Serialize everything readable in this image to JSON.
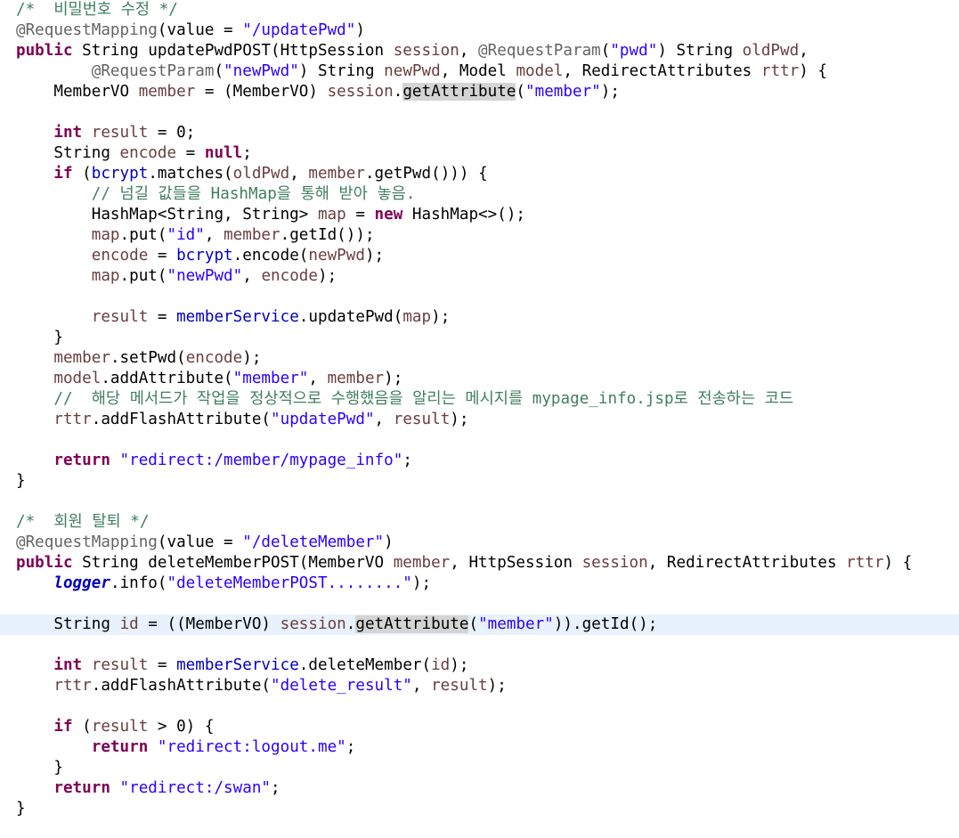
{
  "code_lines": [
    [
      {
        "t": "/*  비밀번호 수정 */",
        "c": "cm"
      }
    ],
    [
      {
        "t": "@RequestMapping",
        "c": "ann"
      },
      {
        "t": "(value = "
      },
      {
        "t": "\"/updatePwd\"",
        "c": "str"
      },
      {
        "t": ")"
      }
    ],
    [
      {
        "t": "public",
        "c": "kw"
      },
      {
        "t": " String updatePwdPOST(HttpSession "
      },
      {
        "t": "session",
        "c": "loc"
      },
      {
        "t": ", "
      },
      {
        "t": "@RequestParam",
        "c": "ann"
      },
      {
        "t": "("
      },
      {
        "t": "\"pwd\"",
        "c": "str"
      },
      {
        "t": ") String "
      },
      {
        "t": "oldPwd",
        "c": "loc"
      },
      {
        "t": ","
      }
    ],
    [
      {
        "t": "        "
      },
      {
        "t": "@RequestParam",
        "c": "ann"
      },
      {
        "t": "("
      },
      {
        "t": "\"newPwd\"",
        "c": "str"
      },
      {
        "t": ") String "
      },
      {
        "t": "newPwd",
        "c": "loc"
      },
      {
        "t": ", Model "
      },
      {
        "t": "model",
        "c": "loc"
      },
      {
        "t": ", RedirectAttributes "
      },
      {
        "t": "rttr",
        "c": "loc"
      },
      {
        "t": ") {"
      }
    ],
    [
      {
        "t": "    MemberVO "
      },
      {
        "t": "member",
        "c": "loc"
      },
      {
        "t": " = (MemberVO) "
      },
      {
        "t": "session",
        "c": "loc"
      },
      {
        "t": "."
      },
      {
        "t": "getAttribute",
        "c": "hl"
      },
      {
        "t": "("
      },
      {
        "t": "\"member\"",
        "c": "str"
      },
      {
        "t": ");"
      }
    ],
    [],
    [
      {
        "t": "    "
      },
      {
        "t": "int",
        "c": "kw"
      },
      {
        "t": " "
      },
      {
        "t": "result",
        "c": "loc"
      },
      {
        "t": " = 0;"
      }
    ],
    [
      {
        "t": "    String "
      },
      {
        "t": "encode",
        "c": "loc"
      },
      {
        "t": " = "
      },
      {
        "t": "null",
        "c": "kw"
      },
      {
        "t": ";"
      }
    ],
    [
      {
        "t": "    "
      },
      {
        "t": "if",
        "c": "kw"
      },
      {
        "t": " ("
      },
      {
        "t": "bcrypt",
        "c": "fld"
      },
      {
        "t": ".matches("
      },
      {
        "t": "oldPwd",
        "c": "loc"
      },
      {
        "t": ", "
      },
      {
        "t": "member",
        "c": "loc"
      },
      {
        "t": ".getPwd())) {"
      }
    ],
    [
      {
        "t": "        "
      },
      {
        "t": "// 넘길 값들을 HashMap을 통해 받아 놓음.",
        "c": "cm"
      }
    ],
    [
      {
        "t": "        HashMap<String, String> "
      },
      {
        "t": "map",
        "c": "loc"
      },
      {
        "t": " = "
      },
      {
        "t": "new",
        "c": "kw"
      },
      {
        "t": " HashMap<>();"
      }
    ],
    [
      {
        "t": "        "
      },
      {
        "t": "map",
        "c": "loc"
      },
      {
        "t": ".put("
      },
      {
        "t": "\"id\"",
        "c": "str"
      },
      {
        "t": ", "
      },
      {
        "t": "member",
        "c": "loc"
      },
      {
        "t": ".getId());"
      }
    ],
    [
      {
        "t": "        "
      },
      {
        "t": "encode",
        "c": "loc"
      },
      {
        "t": " = "
      },
      {
        "t": "bcrypt",
        "c": "fld"
      },
      {
        "t": ".encode("
      },
      {
        "t": "newPwd",
        "c": "loc"
      },
      {
        "t": ");"
      }
    ],
    [
      {
        "t": "        "
      },
      {
        "t": "map",
        "c": "loc"
      },
      {
        "t": ".put("
      },
      {
        "t": "\"newPwd\"",
        "c": "str"
      },
      {
        "t": ", "
      },
      {
        "t": "encode",
        "c": "loc"
      },
      {
        "t": ");"
      }
    ],
    [],
    [
      {
        "t": "        "
      },
      {
        "t": "result",
        "c": "loc"
      },
      {
        "t": " = "
      },
      {
        "t": "memberService",
        "c": "fld"
      },
      {
        "t": ".updatePwd("
      },
      {
        "t": "map",
        "c": "loc"
      },
      {
        "t": ");"
      }
    ],
    [
      {
        "t": "    }"
      }
    ],
    [
      {
        "t": "    "
      },
      {
        "t": "member",
        "c": "loc"
      },
      {
        "t": ".setPwd("
      },
      {
        "t": "encode",
        "c": "loc"
      },
      {
        "t": ");"
      }
    ],
    [
      {
        "t": "    "
      },
      {
        "t": "model",
        "c": "loc"
      },
      {
        "t": ".addAttribute("
      },
      {
        "t": "\"member\"",
        "c": "str"
      },
      {
        "t": ", "
      },
      {
        "t": "member",
        "c": "loc"
      },
      {
        "t": ");"
      }
    ],
    [
      {
        "t": "    "
      },
      {
        "t": "//  해당 메서드가 작업을 정상적으로 수행했음을 알리는 메시지를 mypage_info.jsp로 전송하는 코드",
        "c": "cm"
      }
    ],
    [
      {
        "t": "    "
      },
      {
        "t": "rttr",
        "c": "loc"
      },
      {
        "t": ".addFlashAttribute("
      },
      {
        "t": "\"updatePwd\"",
        "c": "str"
      },
      {
        "t": ", "
      },
      {
        "t": "result",
        "c": "loc"
      },
      {
        "t": ");"
      }
    ],
    [],
    [
      {
        "t": "    "
      },
      {
        "t": "return",
        "c": "kw"
      },
      {
        "t": " "
      },
      {
        "t": "\"redirect:/member/mypage_info\"",
        "c": "str"
      },
      {
        "t": ";"
      }
    ],
    [
      {
        "t": "}"
      }
    ],
    [],
    [
      {
        "t": "/*  회원 탈퇴 */",
        "c": "cm"
      }
    ],
    [
      {
        "t": "@RequestMapping",
        "c": "ann"
      },
      {
        "t": "(value = "
      },
      {
        "t": "\"/deleteMember\"",
        "c": "str"
      },
      {
        "t": ")"
      }
    ],
    [
      {
        "t": "public",
        "c": "kw"
      },
      {
        "t": " String deleteMemberPOST(MemberVO "
      },
      {
        "t": "member",
        "c": "loc"
      },
      {
        "t": ", HttpSession "
      },
      {
        "t": "session",
        "c": "loc"
      },
      {
        "t": ", RedirectAttributes "
      },
      {
        "t": "rttr",
        "c": "loc"
      },
      {
        "t": ") {"
      }
    ],
    [
      {
        "t": "    "
      },
      {
        "t": "logger",
        "c": "sfld"
      },
      {
        "t": ".info("
      },
      {
        "t": "\"deleteMemberPOST........\"",
        "c": "str"
      },
      {
        "t": ");"
      }
    ],
    [],
    [
      {
        "t": "    String "
      },
      {
        "t": "id",
        "c": "loc"
      },
      {
        "t": " = ((MemberVO) "
      },
      {
        "t": "session",
        "c": "loc"
      },
      {
        "t": "."
      },
      {
        "t": "get",
        "c": "hl"
      },
      {
        "caret": true
      },
      {
        "t": "Attribute",
        "c": "hl"
      },
      {
        "t": "("
      },
      {
        "t": "\"member\"",
        "c": "str"
      },
      {
        "t": ")).getId();"
      }
    ],
    [],
    [
      {
        "t": "    "
      },
      {
        "t": "int",
        "c": "kw"
      },
      {
        "t": " "
      },
      {
        "t": "result",
        "c": "loc"
      },
      {
        "t": " = "
      },
      {
        "t": "memberService",
        "c": "fld"
      },
      {
        "t": ".deleteMember("
      },
      {
        "t": "id",
        "c": "loc"
      },
      {
        "t": ");"
      }
    ],
    [
      {
        "t": "    "
      },
      {
        "t": "rttr",
        "c": "loc"
      },
      {
        "t": ".addFlashAttribute("
      },
      {
        "t": "\"delete_result\"",
        "c": "str"
      },
      {
        "t": ", "
      },
      {
        "t": "result",
        "c": "loc"
      },
      {
        "t": ");"
      }
    ],
    [],
    [
      {
        "t": "    "
      },
      {
        "t": "if",
        "c": "kw"
      },
      {
        "t": " ("
      },
      {
        "t": "result",
        "c": "loc"
      },
      {
        "t": " > 0) {"
      }
    ],
    [
      {
        "t": "        "
      },
      {
        "t": "return",
        "c": "kw"
      },
      {
        "t": " "
      },
      {
        "t": "\"redirect:logout.me\"",
        "c": "str"
      },
      {
        "t": ";"
      }
    ],
    [
      {
        "t": "    }"
      }
    ],
    [
      {
        "t": "    "
      },
      {
        "t": "return",
        "c": "kw"
      },
      {
        "t": " "
      },
      {
        "t": "\"redirect:/swan\"",
        "c": "str"
      },
      {
        "t": ";"
      }
    ],
    [
      {
        "t": "}"
      }
    ]
  ],
  "current_line_index": 30,
  "colors": {
    "keyword": "#7f0055",
    "comment": "#3f7f5f",
    "string": "#2a00ff",
    "annotation": "#646464",
    "field": "#0000c0",
    "local_variable": "#6a3e3e",
    "occurrence_highlight": "#d4d4d4",
    "current_line": "#e8f2fe",
    "background": "#ffffff"
  }
}
